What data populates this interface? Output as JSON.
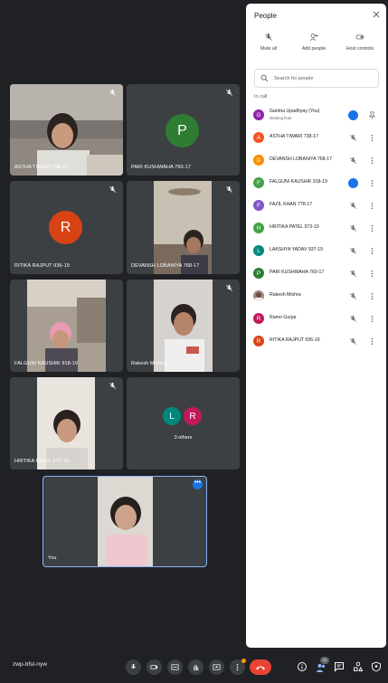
{
  "meeting": {
    "code": "zwp-bfst-nyw"
  },
  "tiles": [
    {
      "name": "ASTHA TIWARI 738-17",
      "kind": "video"
    },
    {
      "name": "PARI KUSHWAHA 760-17",
      "kind": "avatar",
      "initial": "P",
      "color": "#2e7d32"
    },
    {
      "name": "RITIKA RAJPUT 936-19",
      "kind": "avatar",
      "initial": "R",
      "color": "#d84315"
    },
    {
      "name": "DEVANSH LOBANIYA 768-17",
      "kind": "video"
    },
    {
      "name": "FALGUNI KAUSHIK 918-19",
      "kind": "video"
    },
    {
      "name": "Rakesh Mishra",
      "kind": "video"
    },
    {
      "name": "HRITIKA PATEL 973-19",
      "kind": "video"
    },
    {
      "name": "3 others",
      "kind": "others",
      "initials": [
        "L",
        "R"
      ],
      "colors": [
        "#00897b",
        "#c2185b"
      ]
    },
    {
      "name": "You",
      "kind": "self"
    }
  ],
  "controls": {
    "participant_count": "11",
    "icons": [
      "mic-icon",
      "camera-icon",
      "captions-icon",
      "raise-hand-icon",
      "present-icon",
      "more-options-icon",
      "end-call-icon"
    ],
    "right_icons": [
      "info-icon",
      "people-icon",
      "chat-icon",
      "activities-icon",
      "host-controls-icon"
    ]
  },
  "panel": {
    "title": "People",
    "actions": [
      {
        "label": "Mute all",
        "icon": "mic-off-icon"
      },
      {
        "label": "Add people",
        "icon": "add-person-icon"
      },
      {
        "label": "Host controls",
        "icon": "host-controls-icon"
      }
    ],
    "search_placeholder": "Search for people",
    "section_label": "In call",
    "people": [
      {
        "name": "Garima Upadhyay (You)",
        "sub": "Meeting host",
        "initial": "G",
        "color": "#8e24aa",
        "status": "speaking"
      },
      {
        "name": "ASTHA TIWARI 738-17",
        "initial": "A",
        "color": "#f4511e",
        "status": "muted"
      },
      {
        "name": "DEVANSH LOBANIYA 768-17",
        "initial": "D",
        "color": "#fb8c00",
        "status": "muted"
      },
      {
        "name": "FALGUNI KAUSHIK 918-19",
        "initial": "F",
        "color": "#43a047",
        "status": "speaking"
      },
      {
        "name": "FAZIL KHAN 778-17",
        "initial": "F",
        "color": "#7e57c2",
        "status": "muted"
      },
      {
        "name": "HRITIKA PATEL 973-19",
        "initial": "H",
        "color": "#43a047",
        "status": "muted"
      },
      {
        "name": "LAKSHYA YADAV 937-19",
        "initial": "L",
        "color": "#00897b",
        "status": "muted"
      },
      {
        "name": "PARI KUSHWAHA 760-17",
        "initial": "P",
        "color": "#2e7d32",
        "status": "muted"
      },
      {
        "name": "Rakesh Mishra",
        "initial": "",
        "color": "#a1887f",
        "status": "muted"
      },
      {
        "name": "Ramo Gurjar",
        "initial": "R",
        "color": "#c2185b",
        "status": "muted"
      },
      {
        "name": "RITIKA RAJPUT 936-19",
        "initial": "R",
        "color": "#d84315",
        "status": "muted"
      }
    ]
  }
}
